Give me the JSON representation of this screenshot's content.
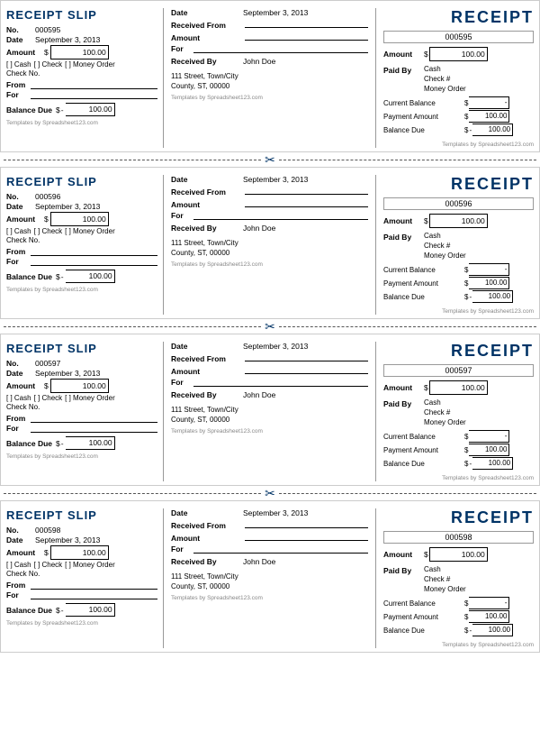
{
  "receipts": [
    {
      "slip_no": "000595",
      "slip_date": "September 3, 2013",
      "slip_amount_dollar": "$",
      "slip_amount": "100.00",
      "payment_cash": "[ ] Cash",
      "payment_check": "[ ] Check",
      "payment_money": "[ ] Money Order",
      "check_no_label": "Check No.",
      "from_label": "From",
      "for_label": "For",
      "balance_due_label": "Balance Due",
      "balance_dollar": "$",
      "balance_dash": "-",
      "balance_amount": "100.00",
      "mid_date_label": "Date",
      "mid_date": "September 3, 2013",
      "mid_received_from_label": "Received From",
      "mid_amount_label": "Amount",
      "mid_for_label": "For",
      "mid_received_by_label": "Received By",
      "mid_received_by": "John Doe",
      "mid_address1": "111 Street, Town/City",
      "mid_address2": "County, ST, 00000",
      "mid_template": "Templates by Spreadsheet123.com",
      "receipt_title": "RECEIPT",
      "receipt_no": "000595",
      "right_amount_label": "Amount",
      "right_dollar": "$",
      "right_amount": "100.00",
      "right_paid_by_label": "Paid By",
      "right_paid_cash": "Cash",
      "right_paid_check": "Check #",
      "right_paid_money": "Money Order",
      "right_current_balance_label": "Current Balance",
      "right_current_balance_dollar": "$",
      "right_current_balance": "-",
      "right_payment_amount_label": "Payment Amount",
      "right_payment_dollar": "$",
      "right_payment_amount": "100.00",
      "right_balance_due_label": "Balance Due",
      "right_balance_dollar": "$",
      "right_balance_dash": "-",
      "right_balance": "100.00",
      "template_credit_left": "Templates by Spreadsheet123.com",
      "template_credit_right": "Templates by Spreadsheet123.com"
    },
    {
      "slip_no": "000596",
      "slip_date": "September 3, 2013",
      "slip_amount_dollar": "$",
      "slip_amount": "100.00",
      "payment_cash": "[ ] Cash",
      "payment_check": "[ ] Check",
      "payment_money": "[ ] Money Order",
      "check_no_label": "Check No.",
      "from_label": "From",
      "for_label": "For",
      "balance_due_label": "Balance Due",
      "balance_dollar": "$",
      "balance_dash": "-",
      "balance_amount": "100.00",
      "mid_date_label": "Date",
      "mid_date": "September 3, 2013",
      "mid_received_from_label": "Received From",
      "mid_amount_label": "Amount",
      "mid_for_label": "For",
      "mid_received_by_label": "Received By",
      "mid_received_by": "John Doe",
      "mid_address1": "111 Street, Town/City",
      "mid_address2": "County, ST, 00000",
      "mid_template": "Templates by Spreadsheet123.com",
      "receipt_title": "RECEIPT",
      "receipt_no": "000596",
      "right_amount_label": "Amount",
      "right_dollar": "$",
      "right_amount": "100.00",
      "right_paid_by_label": "Paid By",
      "right_paid_cash": "Cash",
      "right_paid_check": "Check #",
      "right_paid_money": "Money Order",
      "right_current_balance_label": "Current Balance",
      "right_current_balance_dollar": "$",
      "right_current_balance": "-",
      "right_payment_amount_label": "Payment Amount",
      "right_payment_dollar": "$",
      "right_payment_amount": "100.00",
      "right_balance_due_label": "Balance Due",
      "right_balance_dollar": "$",
      "right_balance_dash": "-",
      "right_balance": "100.00",
      "template_credit_left": "Templates by Spreadsheet123.com",
      "template_credit_right": "Templates by Spreadsheet123.com"
    },
    {
      "slip_no": "000597",
      "slip_date": "September 3, 2013",
      "slip_amount_dollar": "$",
      "slip_amount": "100.00",
      "payment_cash": "[ ] Cash",
      "payment_check": "[ ] Check",
      "payment_money": "[ ] Money Order",
      "check_no_label": "Check No.",
      "from_label": "From",
      "for_label": "For",
      "balance_due_label": "Balance Due",
      "balance_dollar": "$",
      "balance_dash": "-",
      "balance_amount": "100.00",
      "mid_date_label": "Date",
      "mid_date": "September 3, 2013",
      "mid_received_from_label": "Received From",
      "mid_amount_label": "Amount",
      "mid_for_label": "For",
      "mid_received_by_label": "Received By",
      "mid_received_by": "John Doe",
      "mid_address1": "111 Street, Town/City",
      "mid_address2": "County, ST, 00000",
      "mid_template": "Templates by Spreadsheet123.com",
      "receipt_title": "RECEIPT",
      "receipt_no": "000597",
      "right_amount_label": "Amount",
      "right_dollar": "$",
      "right_amount": "100.00",
      "right_paid_by_label": "Paid By",
      "right_paid_cash": "Cash",
      "right_paid_check": "Check #",
      "right_paid_money": "Money Order",
      "right_current_balance_label": "Current Balance",
      "right_current_balance_dollar": "$",
      "right_current_balance": "-",
      "right_payment_amount_label": "Payment Amount",
      "right_payment_dollar": "$",
      "right_payment_amount": "100.00",
      "right_balance_due_label": "Balance Due",
      "right_balance_dollar": "$",
      "right_balance_dash": "-",
      "right_balance": "100.00",
      "template_credit_left": "Templates by Spreadsheet123.com",
      "template_credit_right": "Templates by Spreadsheet123.com"
    },
    {
      "slip_no": "000598",
      "slip_date": "September 3, 2013",
      "slip_amount_dollar": "$",
      "slip_amount": "100.00",
      "payment_cash": "[ ] Cash",
      "payment_check": "[ ] Check",
      "payment_money": "[ ] Money Order",
      "check_no_label": "Check No.",
      "from_label": "From",
      "for_label": "For",
      "balance_due_label": "Balance Due",
      "balance_dollar": "$",
      "balance_dash": "-",
      "balance_amount": "100.00",
      "mid_date_label": "Date",
      "mid_date": "September 3, 2013",
      "mid_received_from_label": "Received From",
      "mid_amount_label": "Amount",
      "mid_for_label": "For",
      "mid_received_by_label": "Received By",
      "mid_received_by": "John Doe",
      "mid_address1": "111 Street, Town/City",
      "mid_address2": "County, ST, 00000",
      "mid_template": "Templates by Spreadsheet123.com",
      "receipt_title": "RECEIPT",
      "receipt_no": "000598",
      "right_amount_label": "Amount",
      "right_dollar": "$",
      "right_amount": "100.00",
      "right_paid_by_label": "Paid By",
      "right_paid_cash": "Cash",
      "right_paid_check": "Check #",
      "right_paid_money": "Money Order",
      "right_current_balance_label": "Current Balance",
      "right_current_balance_dollar": "$",
      "right_current_balance": "-",
      "right_payment_amount_label": "Payment Amount",
      "right_payment_dollar": "$",
      "right_payment_amount": "100.00",
      "right_balance_due_label": "Balance Due",
      "right_balance_dollar": "$",
      "right_balance_dash": "-",
      "right_balance": "100.00",
      "template_credit_left": "Templates by Spreadsheet123.com",
      "template_credit_right": "Templates by Spreadsheet123.com"
    }
  ],
  "slip_title": "RECEIPT SLIP",
  "no_label": "No.",
  "date_label": "Date"
}
